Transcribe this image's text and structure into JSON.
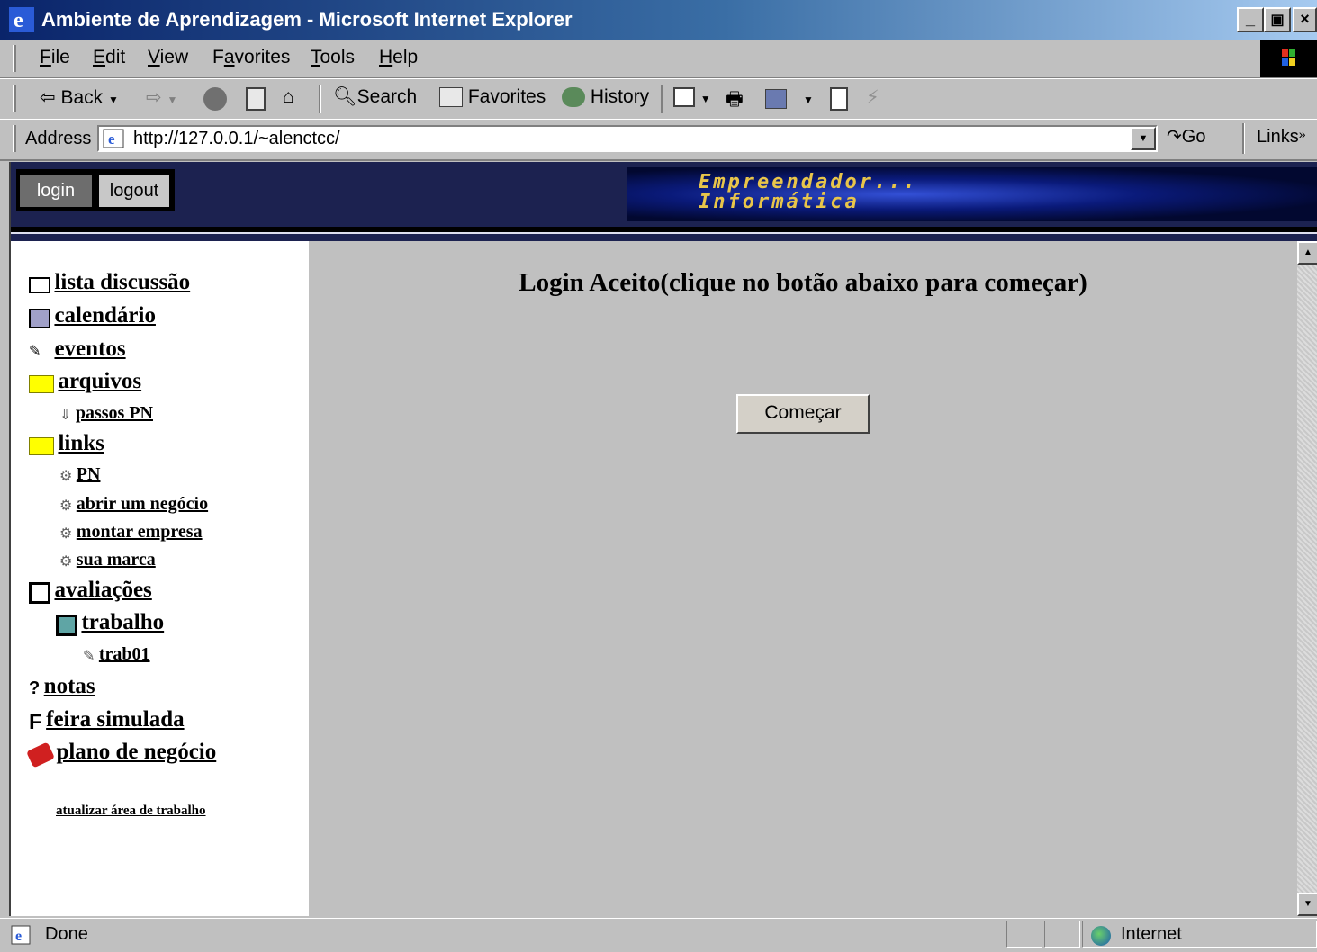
{
  "window": {
    "title": "Ambiente de Aprendizagem - Microsoft Internet Explorer",
    "controls": {
      "minimize": "_",
      "maximize": "▣",
      "close": "×"
    }
  },
  "menubar": {
    "items": [
      "File",
      "Edit",
      "View",
      "Favorites",
      "Tools",
      "Help"
    ],
    "accel": [
      "F",
      "E",
      "V",
      "a",
      "T",
      "H"
    ]
  },
  "toolbar": {
    "back": "Back",
    "search": "Search",
    "favorites": "Favorites",
    "history": "History"
  },
  "address": {
    "label": "Address",
    "url": "http://127.0.0.1/~alenctcc/",
    "go": "Go",
    "links": "Links"
  },
  "header": {
    "login": "login",
    "logout": "logout",
    "banner_line1": "Empreendador...",
    "banner_line2": "Informática"
  },
  "sidebar": {
    "lista_discussao": "lista discussão",
    "calendario": "calendário",
    "eventos": "eventos",
    "arquivos": "arquivos",
    "passos_pn": "passos PN",
    "links": "links",
    "pn": "PN",
    "abrir_negocio": "abrir um negócio",
    "montar_empresa": "montar empresa",
    "sua_marca": "sua marca",
    "avaliacoes": "avaliações",
    "trabalho": "trabalho",
    "trab01": "trab01",
    "notas": "notas",
    "feira_simulada": "feira simulada",
    "plano_negocio": "plano de negócio",
    "atualizar": "atualizar área de trabalho",
    "feira_letter": "F"
  },
  "main": {
    "heading": "Login Aceito(clique no botão abaixo para começar)",
    "start_button": "Começar"
  },
  "status": {
    "text": "Done",
    "zone": "Internet"
  }
}
